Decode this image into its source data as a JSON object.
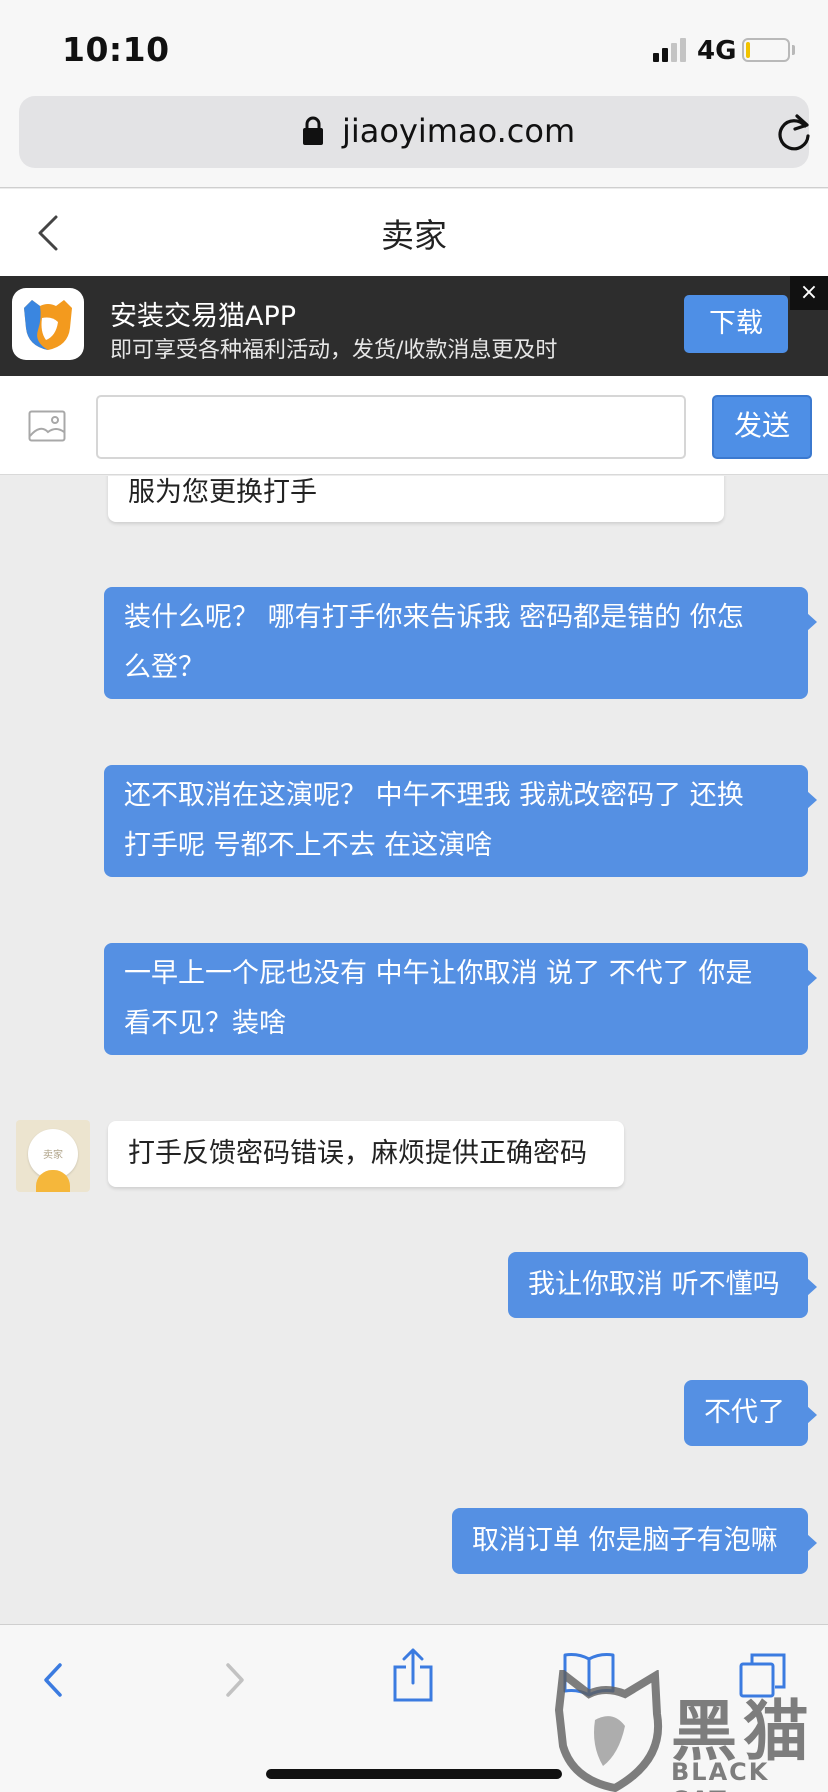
{
  "status_bar": {
    "time": "10:10",
    "network": "4G"
  },
  "browser": {
    "url": "jiaoyimao.com"
  },
  "header": {
    "title": "卖家"
  },
  "app_banner": {
    "title": "安装交易猫APP",
    "subtitle": "即可享受各种福利活动，发货/收款消息更及时",
    "download_label": "下载",
    "close_label": "×"
  },
  "composer": {
    "input_value": "",
    "send_label": "发送"
  },
  "messages": [
    {
      "from": "seller",
      "text": "服为您更换打手"
    },
    {
      "from": "me",
      "line1": "装什么呢？ 哪有打手你来告诉我 密码都是错的 你怎",
      "line2": "么登？"
    },
    {
      "from": "me",
      "line1": "还不取消在这演呢？ 中午不理我 我就改密码了 还换",
      "line2": "打手呢 号都不上不去 在这演啥"
    },
    {
      "from": "me",
      "line1": "一早上一个屁也没有 中午让你取消 说了 不代了 你是",
      "line2": "看不见？装啥"
    },
    {
      "from": "seller",
      "text": "打手反馈密码错误，麻烦提供正确密码",
      "avatar_label": "卖家"
    },
    {
      "from": "me",
      "text": "我让你取消 听不懂吗"
    },
    {
      "from": "me",
      "text": "不代了"
    },
    {
      "from": "me",
      "text": "取消订单 你是脑子有泡嘛"
    }
  ],
  "watermark": {
    "glyph": "黑猫",
    "text": "BLACK CAT"
  },
  "colors": {
    "accent": "#5590e3",
    "banner_bg": "#2d2d2d",
    "chat_bg": "#ececec"
  }
}
